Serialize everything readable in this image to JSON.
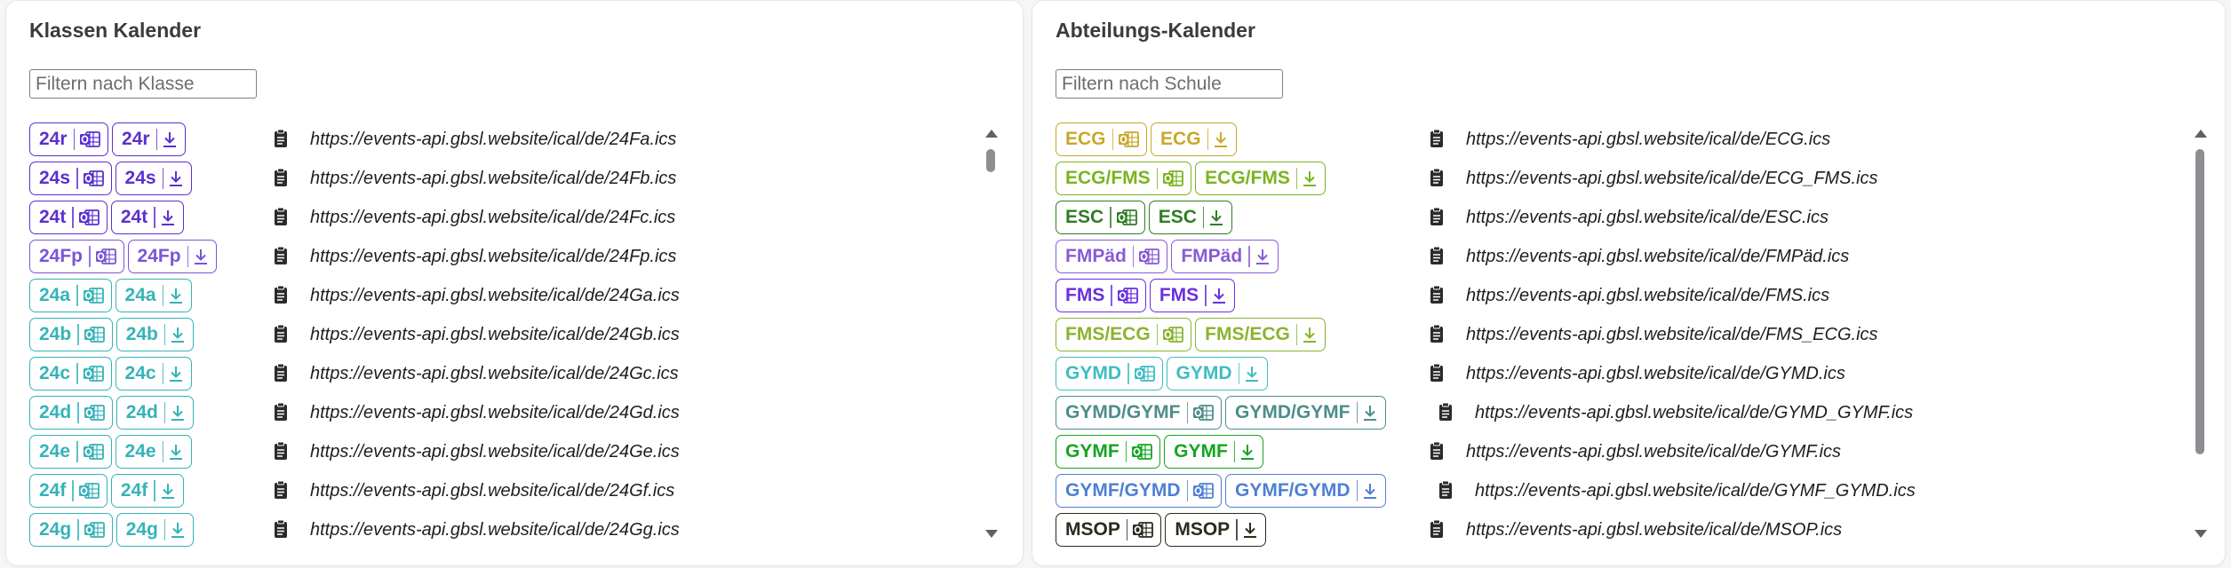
{
  "left": {
    "title": "Klassen Kalender",
    "filter_placeholder": "Filtern nach Klasse",
    "rows": [
      {
        "label": "24r",
        "color": "#5b2fd1",
        "url": "https://events-api.gbsl.website/ical/de/24Fa.ics"
      },
      {
        "label": "24s",
        "color": "#5b2fd1",
        "url": "https://events-api.gbsl.website/ical/de/24Fb.ics"
      },
      {
        "label": "24t",
        "color": "#5b2fd1",
        "url": "https://events-api.gbsl.website/ical/de/24Fc.ics"
      },
      {
        "label": "24Fp",
        "color": "#7a55d8",
        "url": "https://events-api.gbsl.website/ical/de/24Fp.ics"
      },
      {
        "label": "24a",
        "color": "#35b3b8",
        "url": "https://events-api.gbsl.website/ical/de/24Ga.ics"
      },
      {
        "label": "24b",
        "color": "#35b3b8",
        "url": "https://events-api.gbsl.website/ical/de/24Gb.ics"
      },
      {
        "label": "24c",
        "color": "#35b3b8",
        "url": "https://events-api.gbsl.website/ical/de/24Gc.ics"
      },
      {
        "label": "24d",
        "color": "#35b3b8",
        "url": "https://events-api.gbsl.website/ical/de/24Gd.ics"
      },
      {
        "label": "24e",
        "color": "#35b3b8",
        "url": "https://events-api.gbsl.website/ical/de/24Ge.ics"
      },
      {
        "label": "24f",
        "color": "#35b3b8",
        "url": "https://events-api.gbsl.website/ical/de/24Gf.ics"
      },
      {
        "label": "24g",
        "color": "#35b3b8",
        "url": "https://events-api.gbsl.website/ical/de/24Gg.ics"
      }
    ]
  },
  "right": {
    "title": "Abteilungs-Kalender",
    "filter_placeholder": "Filtern nach Schule",
    "rows": [
      {
        "label": "ECG",
        "color": "#c9a82a",
        "url": "https://events-api.gbsl.website/ical/de/ECG.ics"
      },
      {
        "label": "ECG/FMS",
        "color": "#7ab41f",
        "url": "https://events-api.gbsl.website/ical/de/ECG_FMS.ics"
      },
      {
        "label": "ESC",
        "color": "#2f7d24",
        "url": "https://events-api.gbsl.website/ical/de/ESC.ics"
      },
      {
        "label": "FMPäd",
        "color": "#8a5ad6",
        "url": "https://events-api.gbsl.website/ical/de/FMPäd.ics"
      },
      {
        "label": "FMS",
        "color": "#6a2fe0",
        "url": "https://events-api.gbsl.website/ical/de/FMS.ics"
      },
      {
        "label": "FMS/ECG",
        "color": "#8bb32e",
        "url": "https://events-api.gbsl.website/ical/de/FMS_ECG.ics"
      },
      {
        "label": "GYMD",
        "color": "#3dbdc1",
        "url": "https://events-api.gbsl.website/ical/de/GYMD.ics"
      },
      {
        "label": "GYMD/GYMF",
        "color": "#4c8d8b",
        "url": "https://events-api.gbsl.website/ical/de/GYMD_GYMF.ics"
      },
      {
        "label": "GYMF",
        "color": "#14a51e",
        "url": "https://events-api.gbsl.website/ical/de/GYMF.ics"
      },
      {
        "label": "GYMF/GYMD",
        "color": "#4f7fd6",
        "url": "https://events-api.gbsl.website/ical/de/GYMF_GYMD.ics"
      },
      {
        "label": "MSOP",
        "color": "#2b2b1e",
        "url": "https://events-api.gbsl.website/ical/de/MSOP.ics"
      }
    ]
  }
}
